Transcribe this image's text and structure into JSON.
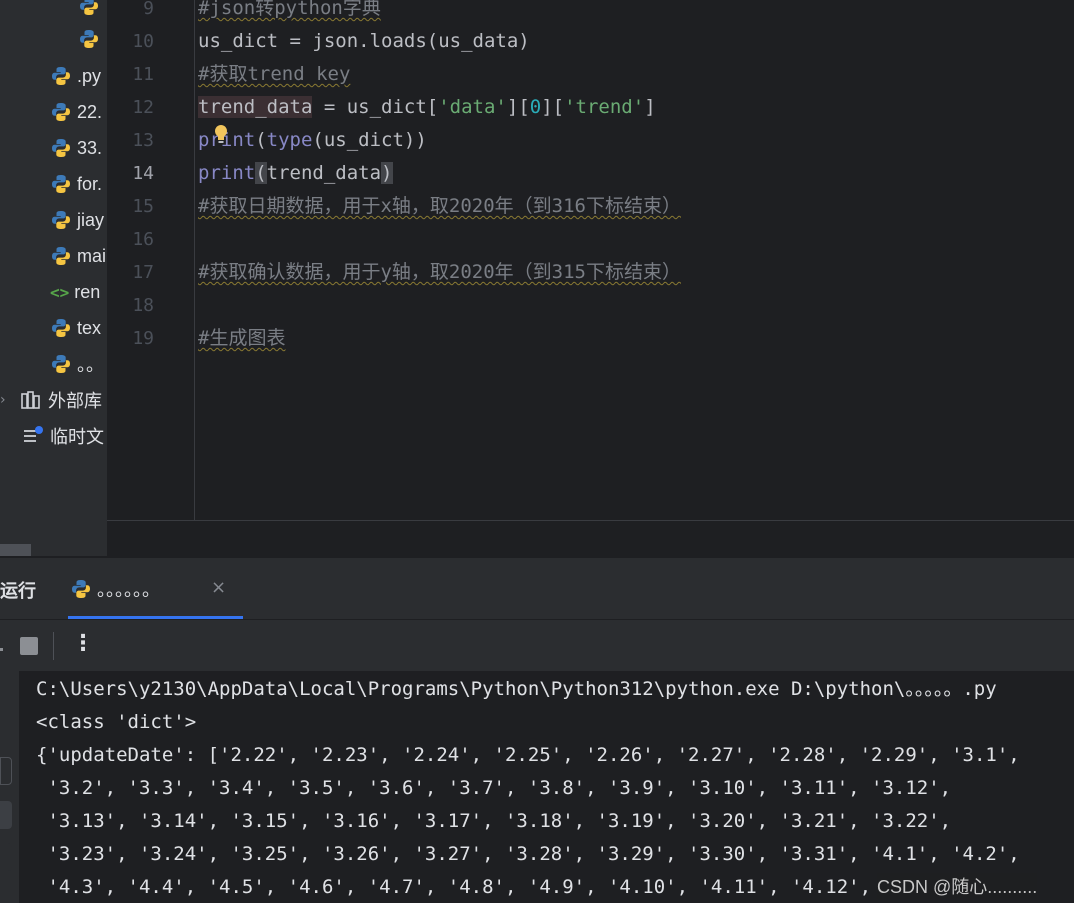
{
  "project_tree": {
    "items": [
      {
        "label": "",
        "icon": "python-file-icon"
      },
      {
        "label": "",
        "icon": "python-file-icon"
      },
      {
        "label": ".py",
        "icon": "python-file-icon"
      },
      {
        "label": "22.",
        "icon": "python-file-icon"
      },
      {
        "label": "33.",
        "icon": "python-file-icon"
      },
      {
        "label": "for.",
        "icon": "python-file-icon"
      },
      {
        "label": "jiay",
        "icon": "python-file-icon"
      },
      {
        "label": "mai",
        "icon": "python-file-icon"
      },
      {
        "label": "ren",
        "icon": "html-file-icon"
      },
      {
        "label": "tex",
        "icon": "python-file-icon"
      },
      {
        "label": "。。",
        "icon": "python-file-icon"
      }
    ],
    "external_libraries": "外部库",
    "scratches": "临时文"
  },
  "editor": {
    "line_numbers": [
      "9",
      "10",
      "11",
      "12",
      "13",
      "14",
      "15",
      "16",
      "17",
      "18",
      "19"
    ],
    "active_line": "14",
    "lines": {
      "l9": "#json转python字典",
      "l10": "us_dict = json.loads(us_data)",
      "l11": "#获取trend key",
      "l12_a": "trend_data",
      "l12_b": " = us_dict[",
      "l12_c": "'data'",
      "l12_d": "][",
      "l12_e": "0",
      "l12_f": "][",
      "l12_g": "'trend'",
      "l12_h": "]",
      "l13_a": "print",
      "l13_b": "(",
      "l13_c": "type",
      "l13_d": "(us_dict))",
      "l14_a": "print",
      "l14_b": "(",
      "l14_c": "trend_data",
      "l14_d": ")",
      "l15": "#获取日期数据，用于x轴，取2020年（到316下标结束）",
      "l17": "#获取确认数据，用于y轴，取2020年（到315下标结束）",
      "l19": "#生成图表"
    }
  },
  "run_panel": {
    "title": "运行",
    "tab_label": "。。。。。。",
    "tab_close": "×",
    "more": "⋮"
  },
  "console": {
    "lines": [
      "C:\\Users\\y2130\\AppData\\Local\\Programs\\Python\\Python312\\python.exe D:\\python\\。。。。。.py",
      "<class 'dict'>",
      "{'updateDate': ['2.22', '2.23', '2.24', '2.25', '2.26', '2.27', '2.28', '2.29', '3.1',",
      " '3.2', '3.3', '3.4', '3.5', '3.6', '3.7', '3.8', '3.9', '3.10', '3.11', '3.12',",
      " '3.13', '3.14', '3.15', '3.16', '3.17', '3.18', '3.19', '3.20', '3.21', '3.22',",
      " '3.23', '3.24', '3.25', '3.26', '3.27', '3.28', '3.29', '3.30', '3.31', '4.1', '4.2',",
      " '4.3', '4.4', '4.5', '4.6', '4.7', '4.8', '4.9', '4.10', '4.11', '4.12',"
    ]
  },
  "watermark": "CSDN @随心..........",
  "colors": {
    "background": "#1e1f22",
    "panel": "#2b2d30",
    "comment": "#7a7e85",
    "string": "#6aab73",
    "number": "#2aacb8",
    "builtin": "#8888c6",
    "accent": "#3574f0"
  }
}
